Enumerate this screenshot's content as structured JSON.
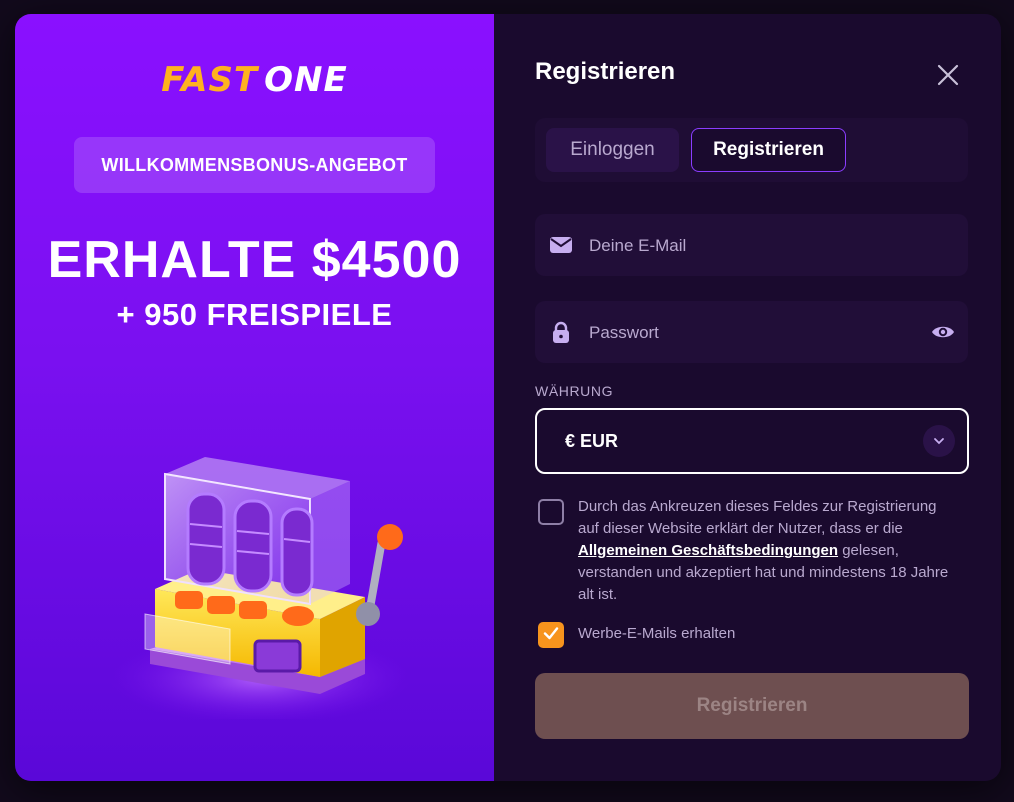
{
  "promo": {
    "logo_fast": "FAST",
    "logo_one": "ONE",
    "bonus_label": "WILLKOMMENSBONUS-ANGEBOT",
    "headline": "ERHALTE $4500",
    "subline": "+ 950 FREISPIELE",
    "image_icon": "slot-machine-icon"
  },
  "form": {
    "title": "Registrieren",
    "close_icon": "close-icon",
    "tabs": [
      {
        "label": "Einloggen",
        "active": false
      },
      {
        "label": "Registrieren",
        "active": true
      }
    ],
    "email": {
      "placeholder": "Deine E-Mail",
      "value": "",
      "icon": "envelope-icon"
    },
    "password": {
      "placeholder": "Passwort",
      "value": "",
      "icon": "lock-icon",
      "toggle_icon": "eye-icon"
    },
    "currency": {
      "label": "WÄHRUNG",
      "selected": "€ EUR",
      "icon": "chevron-down-icon"
    },
    "terms": {
      "checked": false,
      "text_before": "Durch das Ankreuzen dieses Feldes zur Registrierung auf dieser Website erklärt der Nutzer, dass er die ",
      "link": "Allgemeinen Geschäftsbedingungen",
      "text_after": " gelesen, verstanden und akzeptiert hat und mindestens 18 Jahre alt ist."
    },
    "newsletter": {
      "checked": true,
      "label": "Werbe-E-Mails erhalten",
      "icon": "checkmark-icon"
    },
    "submit_label": "Registrieren"
  },
  "colors": {
    "promo_bg": "#8a10ff",
    "form_bg": "#1a0a2e",
    "accent_orange": "#f7941d",
    "logo_gold": "#ffb21e",
    "tab_border": "#8b3dff",
    "submit_bg": "#6e4f50"
  }
}
